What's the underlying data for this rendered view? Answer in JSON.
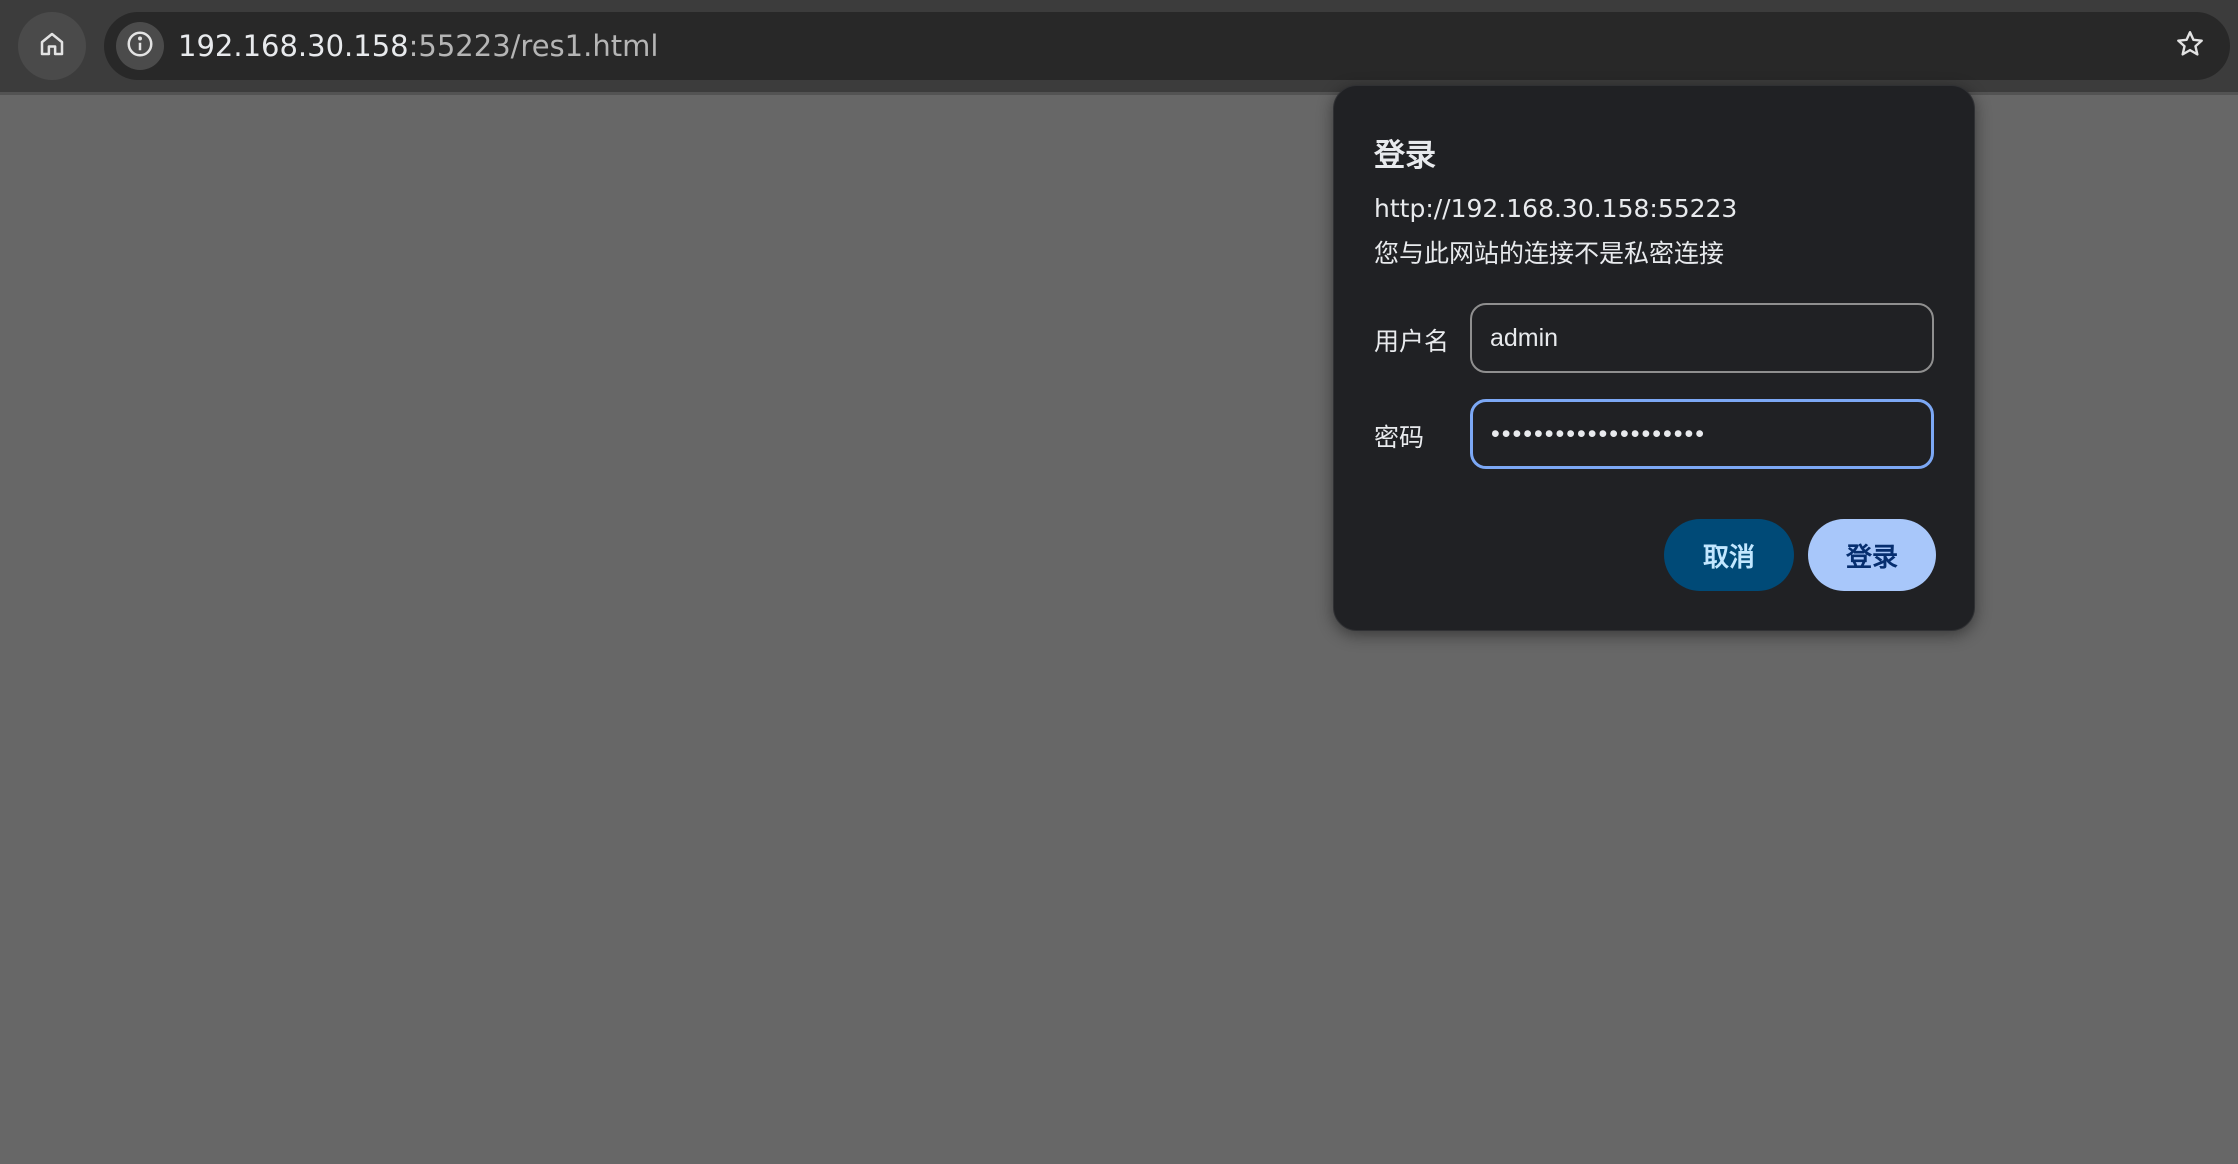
{
  "browser": {
    "url_host": "192.168.30.158",
    "url_rest": ":55223/res1.html",
    "icons": {
      "home": "home-icon",
      "info": "info-icon",
      "bookmark": "star-icon"
    }
  },
  "auth_dialog": {
    "title": "登录",
    "origin": "http://192.168.30.158:55223",
    "warning": "您与此网站的连接不是私密连接",
    "username_label": "用户名",
    "username_value": "admin",
    "password_label": "密码",
    "password_value": "••••••••••••••••••••",
    "cancel_label": "取消",
    "login_label": "登录"
  },
  "colors": {
    "page_background": "#676767",
    "toolbar": "#3c3c3c",
    "dialog_background": "#202124",
    "focus_ring": "#7ca8f5",
    "cancel_button": "#004a77",
    "login_button": "#a8c7fa"
  }
}
